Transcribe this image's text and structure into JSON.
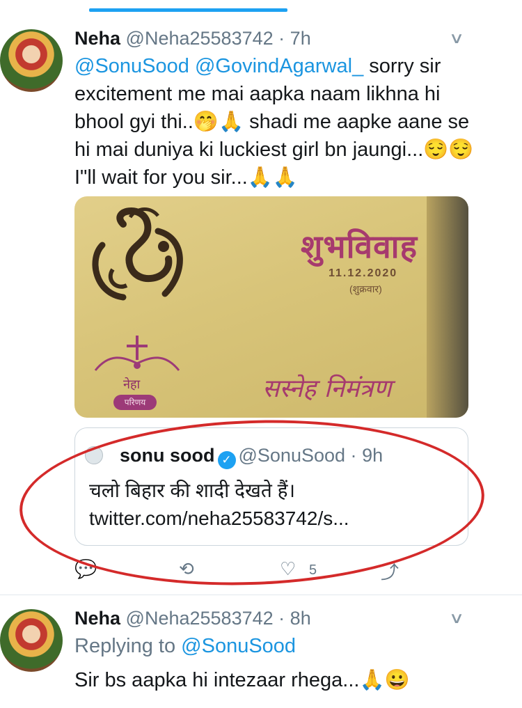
{
  "tweets": [
    {
      "name": "Neha",
      "handle": "@Neha25583742",
      "separator": "·",
      "time": "7h",
      "mentions": [
        "@SonuSood",
        "@GovindAgarwal_"
      ],
      "text_after_mentions": " sorry sir excitement me mai aapka naam likhna hi bhool gyi thi..🤭🙏 shadi me aapke aane se hi mai duniya ki luckiest girl bn jaungi...😌😌 I\"ll wait for you sir...🙏🙏",
      "media": {
        "title": "शुभविवाह",
        "date": "11.12.2020",
        "day": "(शुक्रवार)",
        "bride": "नेहा",
        "pill": "परिणय",
        "invite": "सस्नेह निमंत्रण"
      },
      "quoted": {
        "name": "sonu sood",
        "verified_icon": "✓",
        "handle": "@SonuSood",
        "separator": "·",
        "time": "9h",
        "text": "चलो बिहार की शादी देखते हैं। twitter.com/neha25583742/s..."
      },
      "actions": {
        "reply_icon": "💬",
        "retweet_icon": "⟲",
        "like_icon": "♡",
        "like_count": "5",
        "share_icon": "⤴"
      }
    },
    {
      "name": "Neha",
      "handle": "@Neha25583742",
      "separator": "·",
      "time": "8h",
      "replying_label": "Replying to",
      "replying_to": "@SonuSood",
      "text": "Sir bs aapka hi intezaar rhega...🙏😀"
    }
  ],
  "colors": {
    "accent": "#1da1f2",
    "mention": "#1b95e0",
    "annotation_circle": "#d42a2a"
  }
}
